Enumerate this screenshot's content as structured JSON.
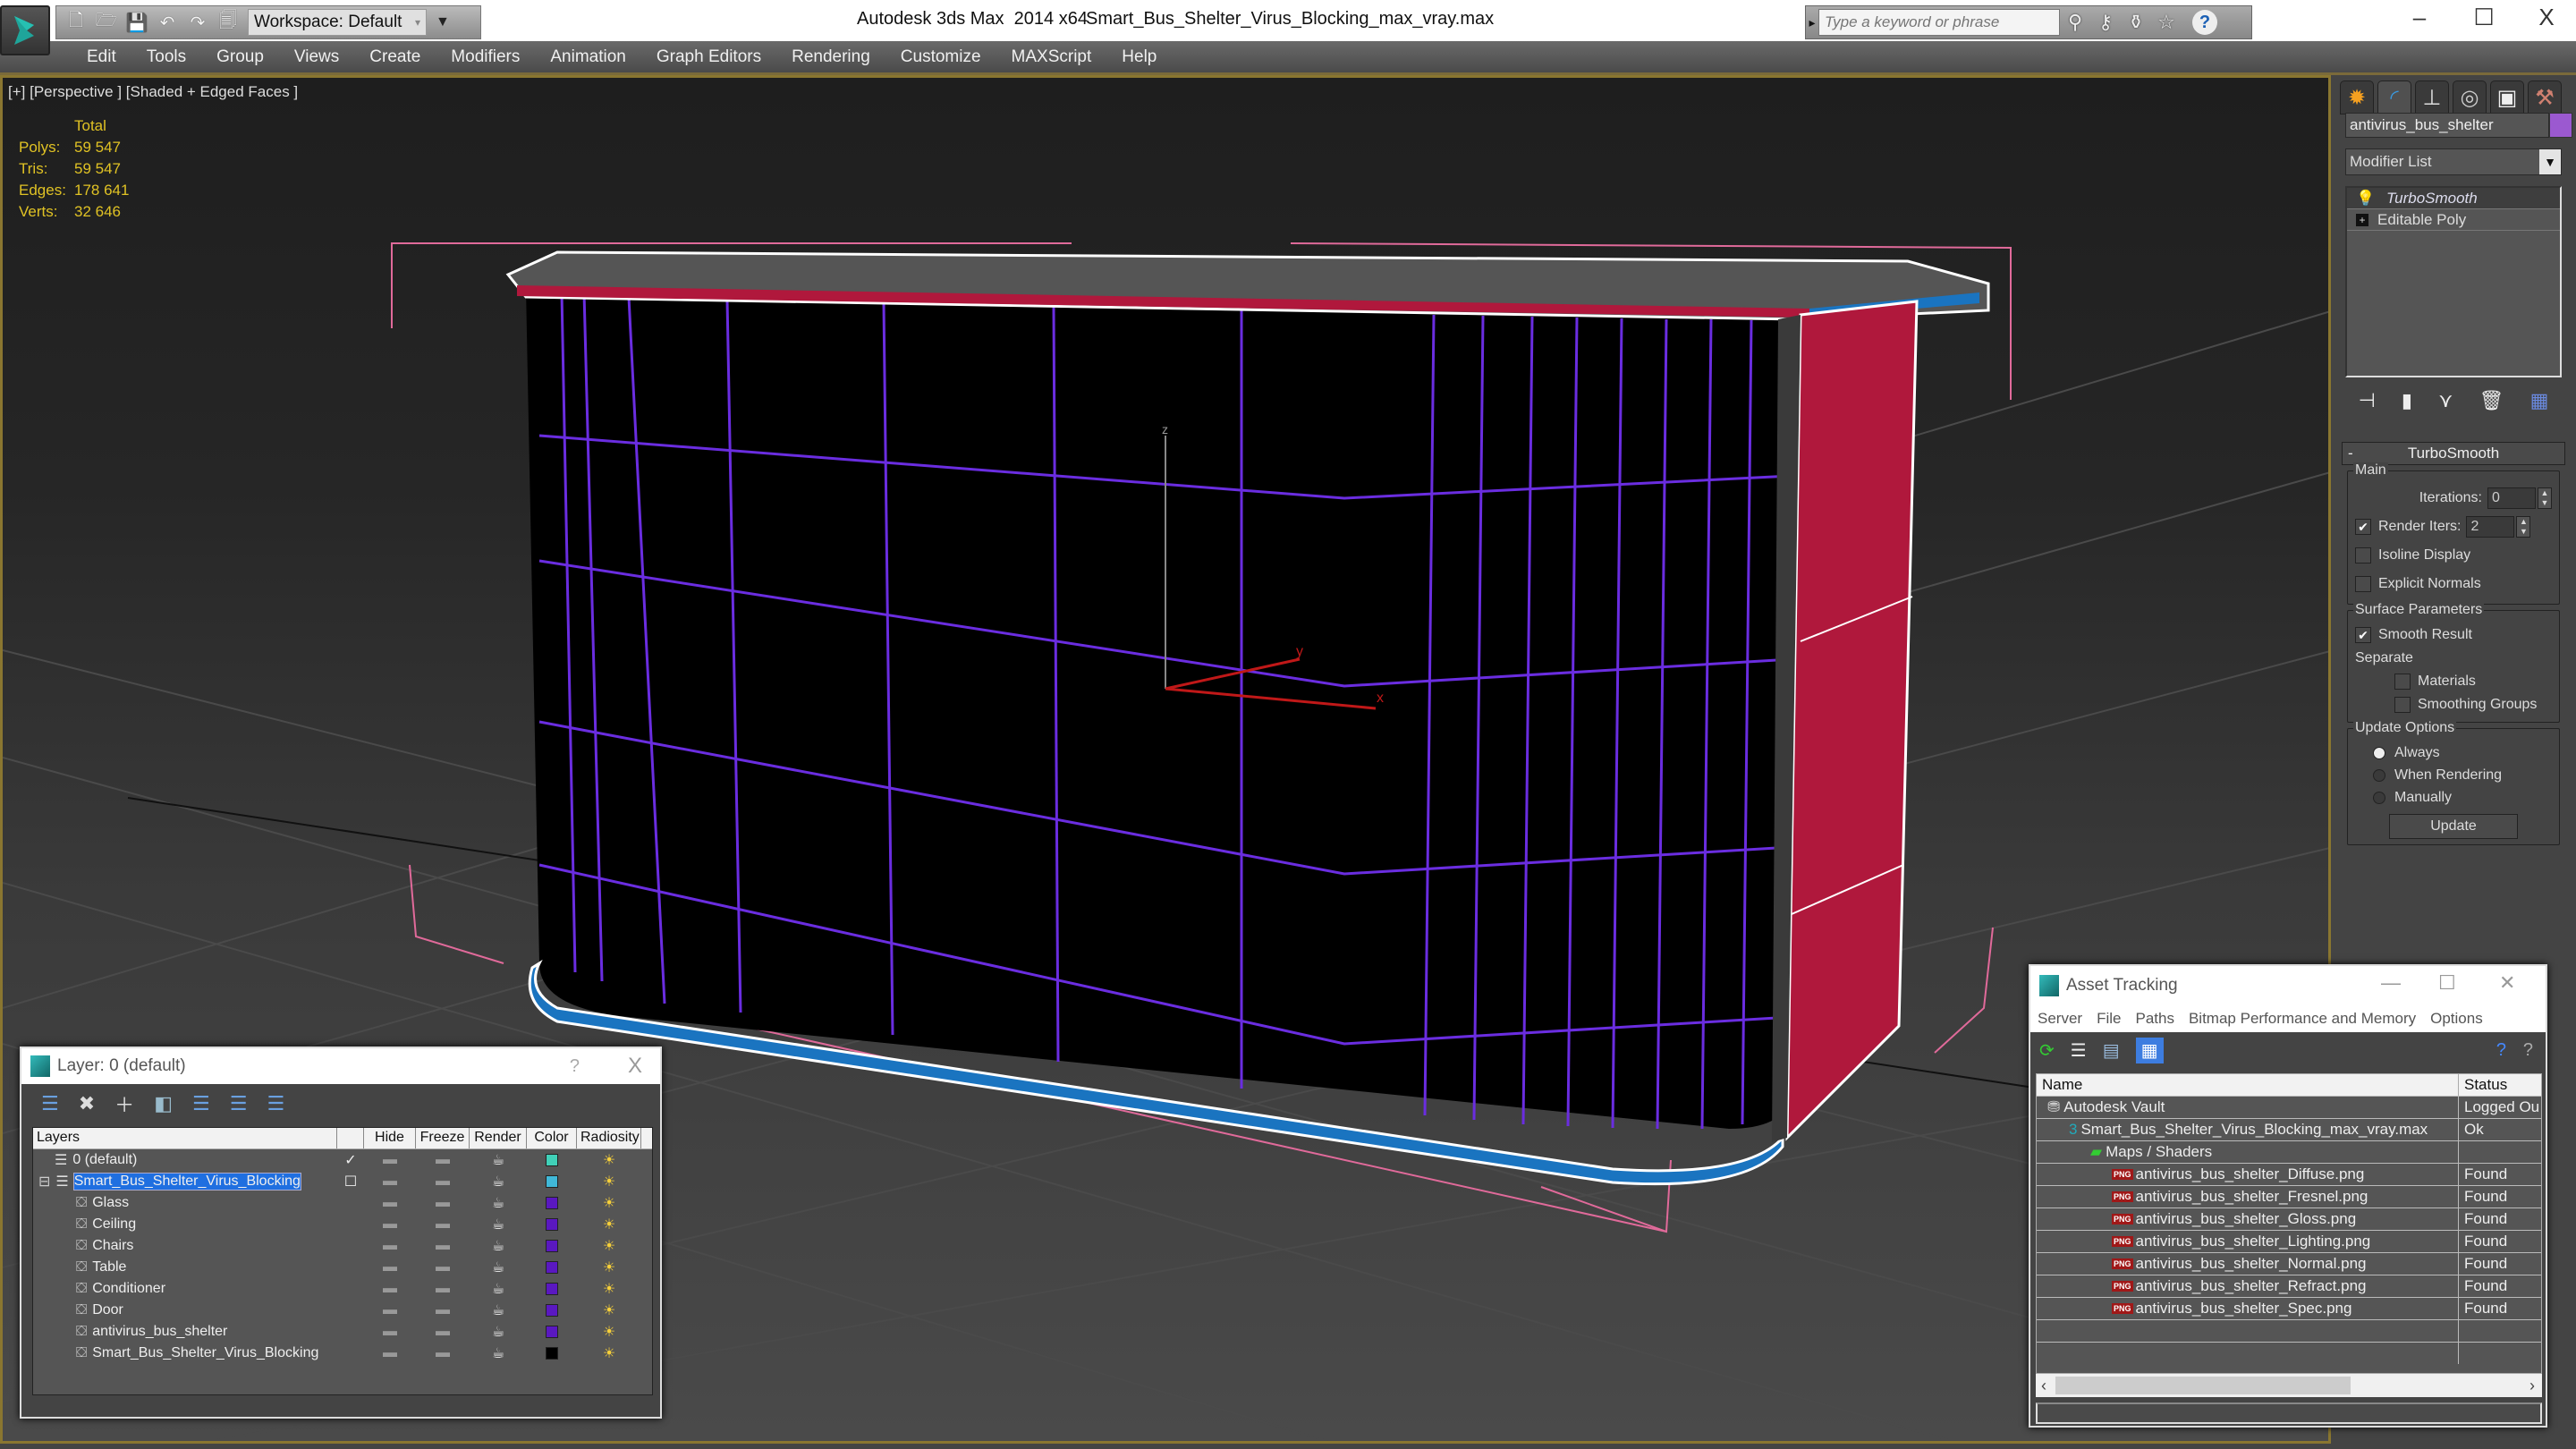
{
  "titlebar": {
    "app_title": "Autodesk 3ds Max  2014 x64",
    "file_name": "Smart_Bus_Shelter_Virus_Blocking_max_vray.max",
    "workspace": "Workspace: Default",
    "search_placeholder": "Type a keyword or phrase",
    "window_controls": {
      "minimize": "–",
      "maximize": "☐",
      "close": "X"
    }
  },
  "quick_access": [
    "new-icon",
    "open-icon",
    "save-icon",
    "undo-icon",
    "redo-icon",
    "project-icon"
  ],
  "menubar": {
    "items": [
      "Edit",
      "Tools",
      "Group",
      "Views",
      "Create",
      "Modifiers",
      "Animation",
      "Graph Editors",
      "Rendering",
      "Customize",
      "MAXScript",
      "Help"
    ]
  },
  "viewport": {
    "label": "[+] [Perspective ] [Shaded + Edged Faces ]",
    "stats": {
      "header": "Total",
      "rows": [
        {
          "label": "Polys:",
          "value": "59 547"
        },
        {
          "label": "Tris:",
          "value": "59 547"
        },
        {
          "label": "Edges:",
          "value": "178 641"
        },
        {
          "label": "Verts:",
          "value": "32 646"
        }
      ]
    },
    "axis_labels": {
      "x": "x",
      "y": "y",
      "z": "z"
    },
    "colors": {
      "wire_purple": "#6a2de0",
      "accent_red": "#b0183c",
      "accent_blue": "#1a74c0",
      "bbox_pink": "#e06a9a",
      "stats_yellow": "#e0c224"
    }
  },
  "command_panel": {
    "tabs": [
      "create-icon",
      "modify-icon",
      "hierarchy-icon",
      "motion-icon",
      "display-icon",
      "utilities-icon"
    ],
    "object_name": "antivirus_bus_shelter",
    "object_color": "#9b59d0",
    "modifier_list": "Modifier List",
    "stack": [
      {
        "name": "TurboSmooth",
        "selected": true
      },
      {
        "name": "Editable Poly",
        "selected": false
      }
    ],
    "turbosmooth": {
      "title": "TurboSmooth",
      "main_label": "Main",
      "iterations_label": "Iterations:",
      "iterations_value": "0",
      "render_iters_label": "Render Iters:",
      "render_iters_value": "2",
      "render_iters_checked": true,
      "isoline_label": "Isoline Display",
      "isoline_checked": false,
      "explicit_normals_label": "Explicit Normals",
      "explicit_normals_checked": false,
      "surface_label": "Surface Parameters",
      "smooth_result_label": "Smooth Result",
      "smooth_result_checked": true,
      "separate_label": "Separate",
      "materials_label": "Materials",
      "smoothing_groups_label": "Smoothing Groups",
      "update_options_label": "Update Options",
      "update_options": [
        "Always",
        "When Rendering",
        "Manually"
      ],
      "update_selected": "Always",
      "update_button": "Update"
    }
  },
  "layer_dialog": {
    "title": "Layer: 0 (default)",
    "help": "?",
    "close": "X",
    "columns": [
      "Layers",
      "",
      "Hide",
      "Freeze",
      "Render",
      "Color",
      "Radiosity"
    ],
    "rows": [
      {
        "name": "0 (default)",
        "level": 0,
        "type": "layer",
        "current": "✓",
        "color": "#40d0b8",
        "selected": false
      },
      {
        "name": "Smart_Bus_Shelter_Virus_Blocking",
        "level": 0,
        "type": "layer",
        "current": "☐",
        "color": "#40b8d8",
        "selected": true,
        "expand": "⊟"
      },
      {
        "name": "Glass",
        "level": 1,
        "type": "object",
        "color": "#5a18c0"
      },
      {
        "name": "Ceiling",
        "level": 1,
        "type": "object",
        "color": "#5a18c0"
      },
      {
        "name": "Chairs",
        "level": 1,
        "type": "object",
        "color": "#5a18c0"
      },
      {
        "name": "Table",
        "level": 1,
        "type": "object",
        "color": "#5a18c0"
      },
      {
        "name": "Conditioner",
        "level": 1,
        "type": "object",
        "color": "#5a18c0"
      },
      {
        "name": "Door",
        "level": 1,
        "type": "object",
        "color": "#5a18c0"
      },
      {
        "name": "antivirus_bus_shelter",
        "level": 1,
        "type": "object",
        "color": "#5a18c0"
      },
      {
        "name": "Smart_Bus_Shelter_Virus_Blocking",
        "level": 1,
        "type": "object",
        "color": "#000000"
      }
    ]
  },
  "asset_dialog": {
    "title": "Asset Tracking",
    "menu": [
      "Server",
      "File",
      "Paths",
      "Bitmap Performance and Memory",
      "Options"
    ],
    "columns": {
      "name": "Name",
      "status": "Status"
    },
    "rows": [
      {
        "name": "Autodesk Vault",
        "status": "Logged Ou",
        "indent": 1,
        "icon": "vault-icon"
      },
      {
        "name": "Smart_Bus_Shelter_Virus_Blocking_max_vray.max",
        "status": "Ok",
        "indent": 2,
        "icon": "max-file-icon"
      },
      {
        "name": "Maps / Shaders",
        "status": "",
        "indent": 3,
        "icon": "maps-icon"
      },
      {
        "name": "antivirus_bus_shelter_Diffuse.png",
        "status": "Found",
        "indent": 4,
        "icon": "png-icon"
      },
      {
        "name": "antivirus_bus_shelter_Fresnel.png",
        "status": "Found",
        "indent": 4,
        "icon": "png-icon"
      },
      {
        "name": "antivirus_bus_shelter_Gloss.png",
        "status": "Found",
        "indent": 4,
        "icon": "png-icon"
      },
      {
        "name": "antivirus_bus_shelter_Lighting.png",
        "status": "Found",
        "indent": 4,
        "icon": "png-icon"
      },
      {
        "name": "antivirus_bus_shelter_Normal.png",
        "status": "Found",
        "indent": 4,
        "icon": "png-icon"
      },
      {
        "name": "antivirus_bus_shelter_Refract.png",
        "status": "Found",
        "indent": 4,
        "icon": "png-icon"
      },
      {
        "name": "antivirus_bus_shelter_Spec.png",
        "status": "Found",
        "indent": 4,
        "icon": "png-icon"
      }
    ]
  }
}
